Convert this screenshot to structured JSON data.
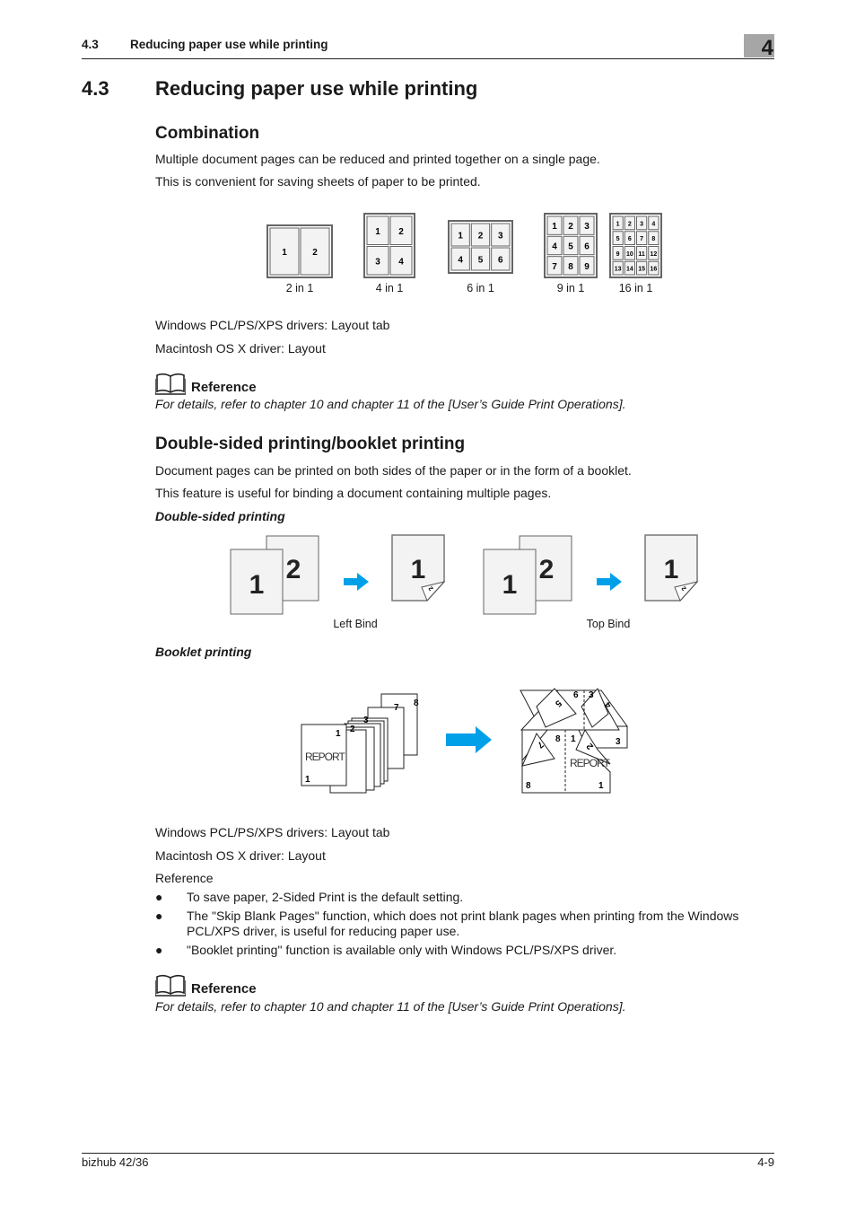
{
  "header": {
    "section_number": "4.3",
    "section_title": "Reducing paper use while printing",
    "chapter": "4"
  },
  "title": {
    "number": "4.3",
    "text": "Reducing paper use while printing"
  },
  "combination": {
    "heading": "Combination",
    "paragraphs": [
      "Multiple document pages can be reduced and printed together on a single page.",
      "This is convenient for saving sheets of paper to be printed."
    ],
    "layouts": [
      {
        "label": "2 in 1",
        "cols": 2,
        "rows": 1
      },
      {
        "label": "4 in 1",
        "cols": 2,
        "rows": 2
      },
      {
        "label": "6 in 1",
        "cols": 3,
        "rows": 2
      },
      {
        "label": "9 in 1",
        "cols": 3,
        "rows": 3
      },
      {
        "label": "16 in 1",
        "cols": 4,
        "rows": 4
      }
    ],
    "drivers": [
      "Windows PCL/PS/XPS drivers: Layout tab",
      "Macintosh OS X driver: Layout"
    ],
    "reference": {
      "icon": "book-icon",
      "label": "Reference",
      "text": "For details, refer to chapter 10 and chapter 11 of the [User’s Guide Print Operations]."
    }
  },
  "duplex": {
    "heading": "Double-sided printing/booklet printing",
    "paragraphs": [
      "Document pages can be printed on both sides of the paper or in the form of a booklet.",
      "This feature is useful for binding a document containing multiple pages."
    ],
    "double_sided_label": "Double-sided printing",
    "figures": [
      {
        "label": "Left Bind",
        "front": "1",
        "back": "2"
      },
      {
        "label": "Top Bind",
        "front": "1",
        "back": "2"
      }
    ],
    "booklet_label": "Booklet printing",
    "booklet": {
      "cover_text": "REPORT",
      "stack_pages": [
        "1",
        "2",
        "3",
        "7",
        "8"
      ],
      "cover_page": "1",
      "folded_pages": [
        "6",
        "3",
        "5",
        "4",
        "3",
        "8",
        "1",
        "7",
        "2",
        "8",
        "1"
      ]
    },
    "arrow_color": "#00a0e9",
    "drivers": [
      "Windows PCL/PS/XPS drivers: Layout tab",
      "Macintosh OS X driver: Layout"
    ],
    "reference_heading": "Reference",
    "bullets": [
      "To save paper, 2-Sided Print is the default setting.",
      "The \"Skip Blank Pages\" function, which does not print blank pages when printing from the Windows PCL/XPS driver, is useful for reducing paper use.",
      "\"Booklet printing\" function is available only with Windows PCL/PS/XPS driver."
    ],
    "reference": {
      "icon": "book-icon",
      "label": "Reference",
      "text": "For details, refer to chapter 10 and chapter 11 of the [User’s Guide Print Operations]."
    }
  },
  "footer": {
    "product": "bizhub 42/36",
    "page": "4-9"
  }
}
